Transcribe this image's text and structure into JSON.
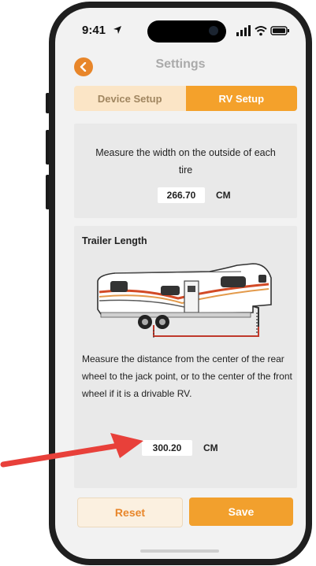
{
  "status_bar": {
    "time": "9:41"
  },
  "header": {
    "title": "Settings"
  },
  "tabs": [
    {
      "label": "Device Setup",
      "active": false
    },
    {
      "label": "RV Setup",
      "active": true
    }
  ],
  "tire_width": {
    "instruction": "Measure the width on the outside of each tire",
    "value": "266.70",
    "unit": "CM"
  },
  "trailer_length": {
    "title": "Trailer Length",
    "instruction": "Measure the distance from the center of the rear wheel to the jack point, or to the center of the front wheel if it is a drivable RV.",
    "value": "300.20",
    "unit": "CM"
  },
  "buttons": {
    "reset": "Reset",
    "save": "Save"
  },
  "colors": {
    "accent": "#f4a12b",
    "back_button": "#e8862a",
    "annotation_arrow": "#e8403a",
    "tab_inactive": "#fbe5c6"
  },
  "icons": [
    "chevron-left-icon",
    "location-arrow-icon",
    "signal-icon",
    "wifi-icon",
    "battery-icon",
    "rv-trailer-illustration"
  ]
}
